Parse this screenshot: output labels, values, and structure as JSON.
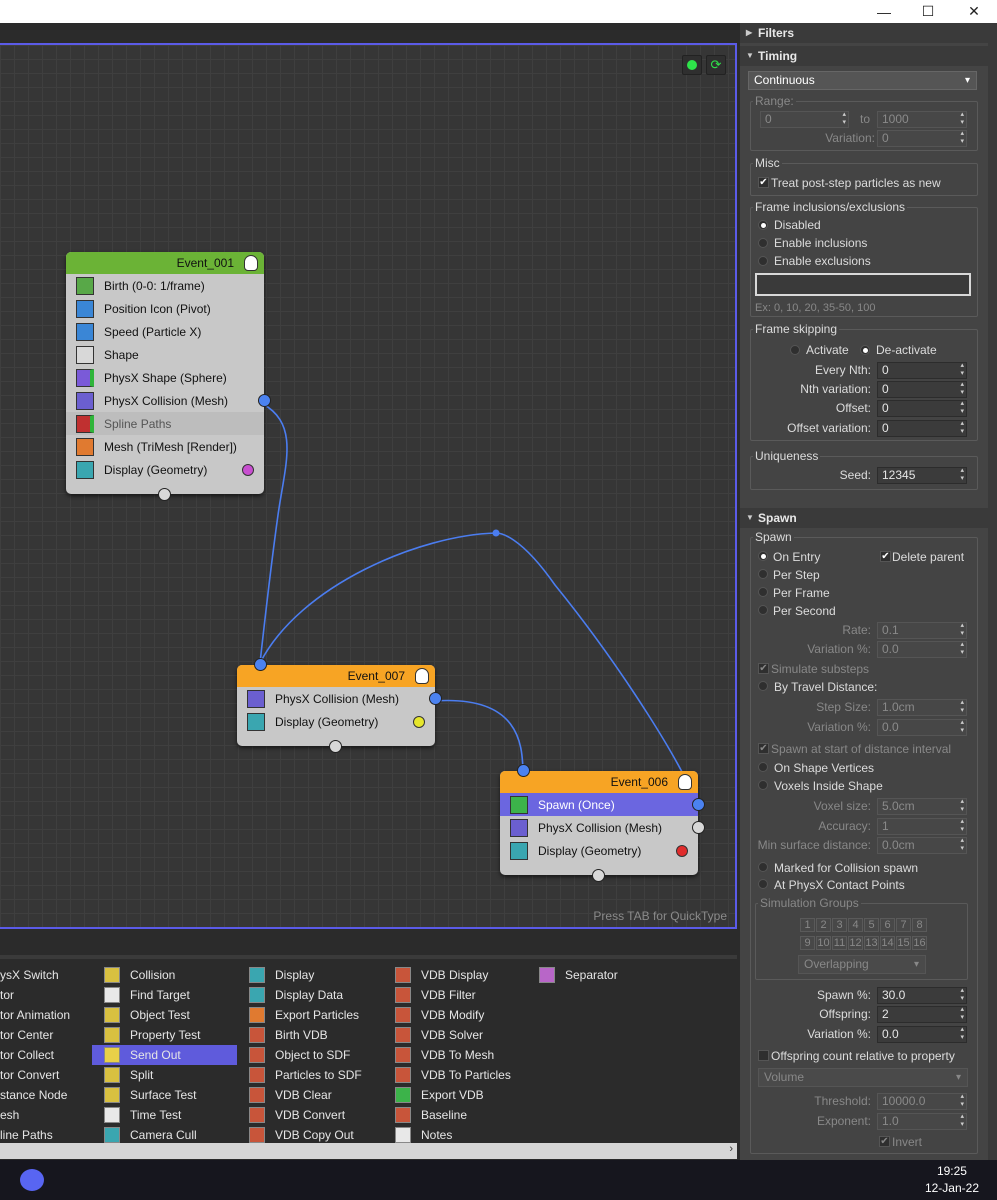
{
  "window": {
    "minimize": "—",
    "maximize": "☐",
    "close": "✕"
  },
  "canvas": {
    "quicktype_hint": "Press TAB for QuickType",
    "nodes": [
      {
        "title": "Event_001",
        "header_color": "#6bb336",
        "rows": [
          {
            "label": "Birth (0-0: 1/frame)",
            "icon": "birth-icon"
          },
          {
            "label": "Position Icon (Pivot)",
            "icon": "position-icon"
          },
          {
            "label": "Speed (Particle X)",
            "icon": "speed-icon"
          },
          {
            "label": "Shape",
            "icon": "shape-icon"
          },
          {
            "label": "PhysX Shape (Sphere)",
            "icon": "physx-shape-icon"
          },
          {
            "label": "PhysX Collision (Mesh)",
            "icon": "physx-collision-icon"
          },
          {
            "label": "Spline Paths",
            "icon": "spline-paths-icon"
          },
          {
            "label": "Mesh (TriMesh [Render])",
            "icon": "mesh-icon"
          },
          {
            "label": "Display (Geometry)",
            "icon": "display-icon"
          }
        ]
      },
      {
        "title": "Event_007",
        "header_color": "#f7a424",
        "rows": [
          {
            "label": "PhysX Collision (Mesh)",
            "icon": "physx-collision-icon"
          },
          {
            "label": "Display (Geometry)",
            "icon": "display-icon"
          }
        ]
      },
      {
        "title": "Event_006",
        "header_color": "#f7a424",
        "rows": [
          {
            "label": "Spawn (Once)",
            "icon": "spawn-icon"
          },
          {
            "label": "PhysX Collision (Mesh)",
            "icon": "physx-collision-icon"
          },
          {
            "label": "Display (Geometry)",
            "icon": "display-icon"
          }
        ]
      }
    ]
  },
  "operators": {
    "col1": [
      "ysX Switch",
      "tor",
      "tor Animation",
      "tor Center",
      "tor Collect",
      "tor Convert",
      "stance Node",
      "esh",
      "line Paths"
    ],
    "col2": [
      "Collision",
      "Find Target",
      "Object Test",
      "Property Test",
      "Send Out",
      "Split",
      "Surface Test",
      "Time Test",
      "Camera Cull"
    ],
    "col3": [
      "Display",
      "Display Data",
      "Export Particles",
      "Birth VDB",
      "Object to SDF",
      "Particles to SDF",
      "VDB Clear",
      "VDB Convert",
      "VDB Copy Out"
    ],
    "col4": [
      "VDB Display",
      "VDB Filter",
      "VDB Modify",
      "VDB Solver",
      "VDB To Mesh",
      "VDB To Particles",
      "Export VDB",
      "Baseline",
      "Notes"
    ],
    "col5": [
      "Separator"
    ]
  },
  "panel": {
    "filters": "Filters",
    "timing": {
      "title": "Timing",
      "mode": "Continuous",
      "range_label": "Range:",
      "range_from": "0",
      "to_label": "to",
      "range_to": "1000",
      "variation_label": "Variation:",
      "variation": "0",
      "misc_label": "Misc",
      "treat_post_step": "Treat post-step particles as new",
      "frame_incl_label": "Frame inclusions/exclusions",
      "disabled": "Disabled",
      "enable_incl": "Enable inclusions",
      "enable_excl": "Enable exclusions",
      "example": "Ex: 0, 10, 20, 35-50, 100",
      "frame_skip_label": "Frame skipping",
      "activate": "Activate",
      "deactivate": "De-activate",
      "every_nth_label": "Every Nth:",
      "every_nth": "0",
      "nth_var_label": "Nth variation:",
      "nth_var": "0",
      "offset_label": "Offset:",
      "offset": "0",
      "offset_var_label": "Offset variation:",
      "offset_var": "0",
      "uniqueness_label": "Uniqueness",
      "seed_label": "Seed:",
      "seed": "12345"
    },
    "spawn": {
      "title": "Spawn",
      "group_label": "Spawn",
      "on_entry": "On Entry",
      "delete_parent": "Delete parent",
      "per_step": "Per Step",
      "per_frame": "Per Frame",
      "per_second": "Per Second",
      "rate_label": "Rate:",
      "rate": "0.1",
      "variation_pct_label": "Variation %:",
      "variation_pct": "0.0",
      "simulate_substeps": "Simulate substeps",
      "by_travel": "By Travel Distance:",
      "step_size_label": "Step Size:",
      "step_size": "1.0cm",
      "variation2_label": "Variation %:",
      "variation2": "0.0",
      "spawn_start": "Spawn at start of distance interval",
      "on_shape_vertices": "On Shape Vertices",
      "voxels_inside": "Voxels Inside Shape",
      "voxel_size_label": "Voxel size:",
      "voxel_size": "5.0cm",
      "accuracy_label": "Accuracy:",
      "accuracy": "1",
      "min_surface_label": "Min surface distance:",
      "min_surface": "0.0cm",
      "marked_collision": "Marked for Collision spawn",
      "physx_contact": "At PhysX Contact Points",
      "sim_groups_label": "Simulation Groups",
      "groups_row1": [
        "1",
        "2",
        "3",
        "4",
        "5",
        "6",
        "7",
        "8"
      ],
      "groups_row2": [
        "9",
        "10",
        "11",
        "12",
        "13",
        "14",
        "15",
        "16"
      ],
      "overlapping": "Overlapping",
      "spawn_pct_label": "Spawn %:",
      "spawn_pct": "30.0",
      "offspring_label": "Offspring:",
      "offspring": "2",
      "variation3_label": "Variation %:",
      "variation3": "0.0",
      "offspring_relative": "Offspring count relative to property",
      "volume": "Volume",
      "threshold_label": "Threshold:",
      "threshold": "10000.0",
      "exponent_label": "Exponent:",
      "exponent": "1.0",
      "invert": "Invert"
    }
  },
  "taskbar": {
    "time": "19:25",
    "date": "12-Jan-22"
  }
}
